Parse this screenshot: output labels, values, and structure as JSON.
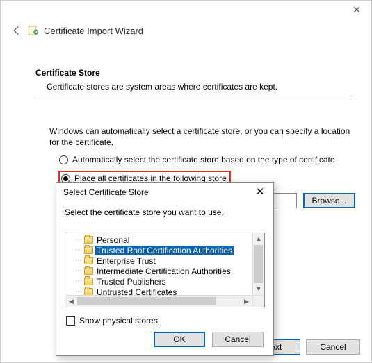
{
  "wizard": {
    "title": "Certificate Import Wizard",
    "section_heading": "Certificate Store",
    "section_desc": "Certificate stores are system areas where certificates are kept.",
    "body_text": "Windows can automatically select a certificate store, or you can specify a location for the certificate.",
    "radio_auto": "Automatically select the certificate store based on the type of certificate",
    "radio_place": "Place all certificates in the following store",
    "browse_label": "Browse...",
    "next_label": "Next",
    "cancel_label": "Cancel"
  },
  "dialog": {
    "title": "Select Certificate Store",
    "instruction": "Select the certificate store you want to use.",
    "show_physical_label": "Show physical stores",
    "ok_label": "OK",
    "cancel_label": "Cancel",
    "tree": [
      {
        "label": "Personal",
        "selected": false
      },
      {
        "label": "Trusted Root Certification Authorities",
        "selected": true
      },
      {
        "label": "Enterprise Trust",
        "selected": false
      },
      {
        "label": "Intermediate Certification Authorities",
        "selected": false
      },
      {
        "label": "Trusted Publishers",
        "selected": false
      },
      {
        "label": "Untrusted Certificates",
        "selected": false
      }
    ]
  }
}
